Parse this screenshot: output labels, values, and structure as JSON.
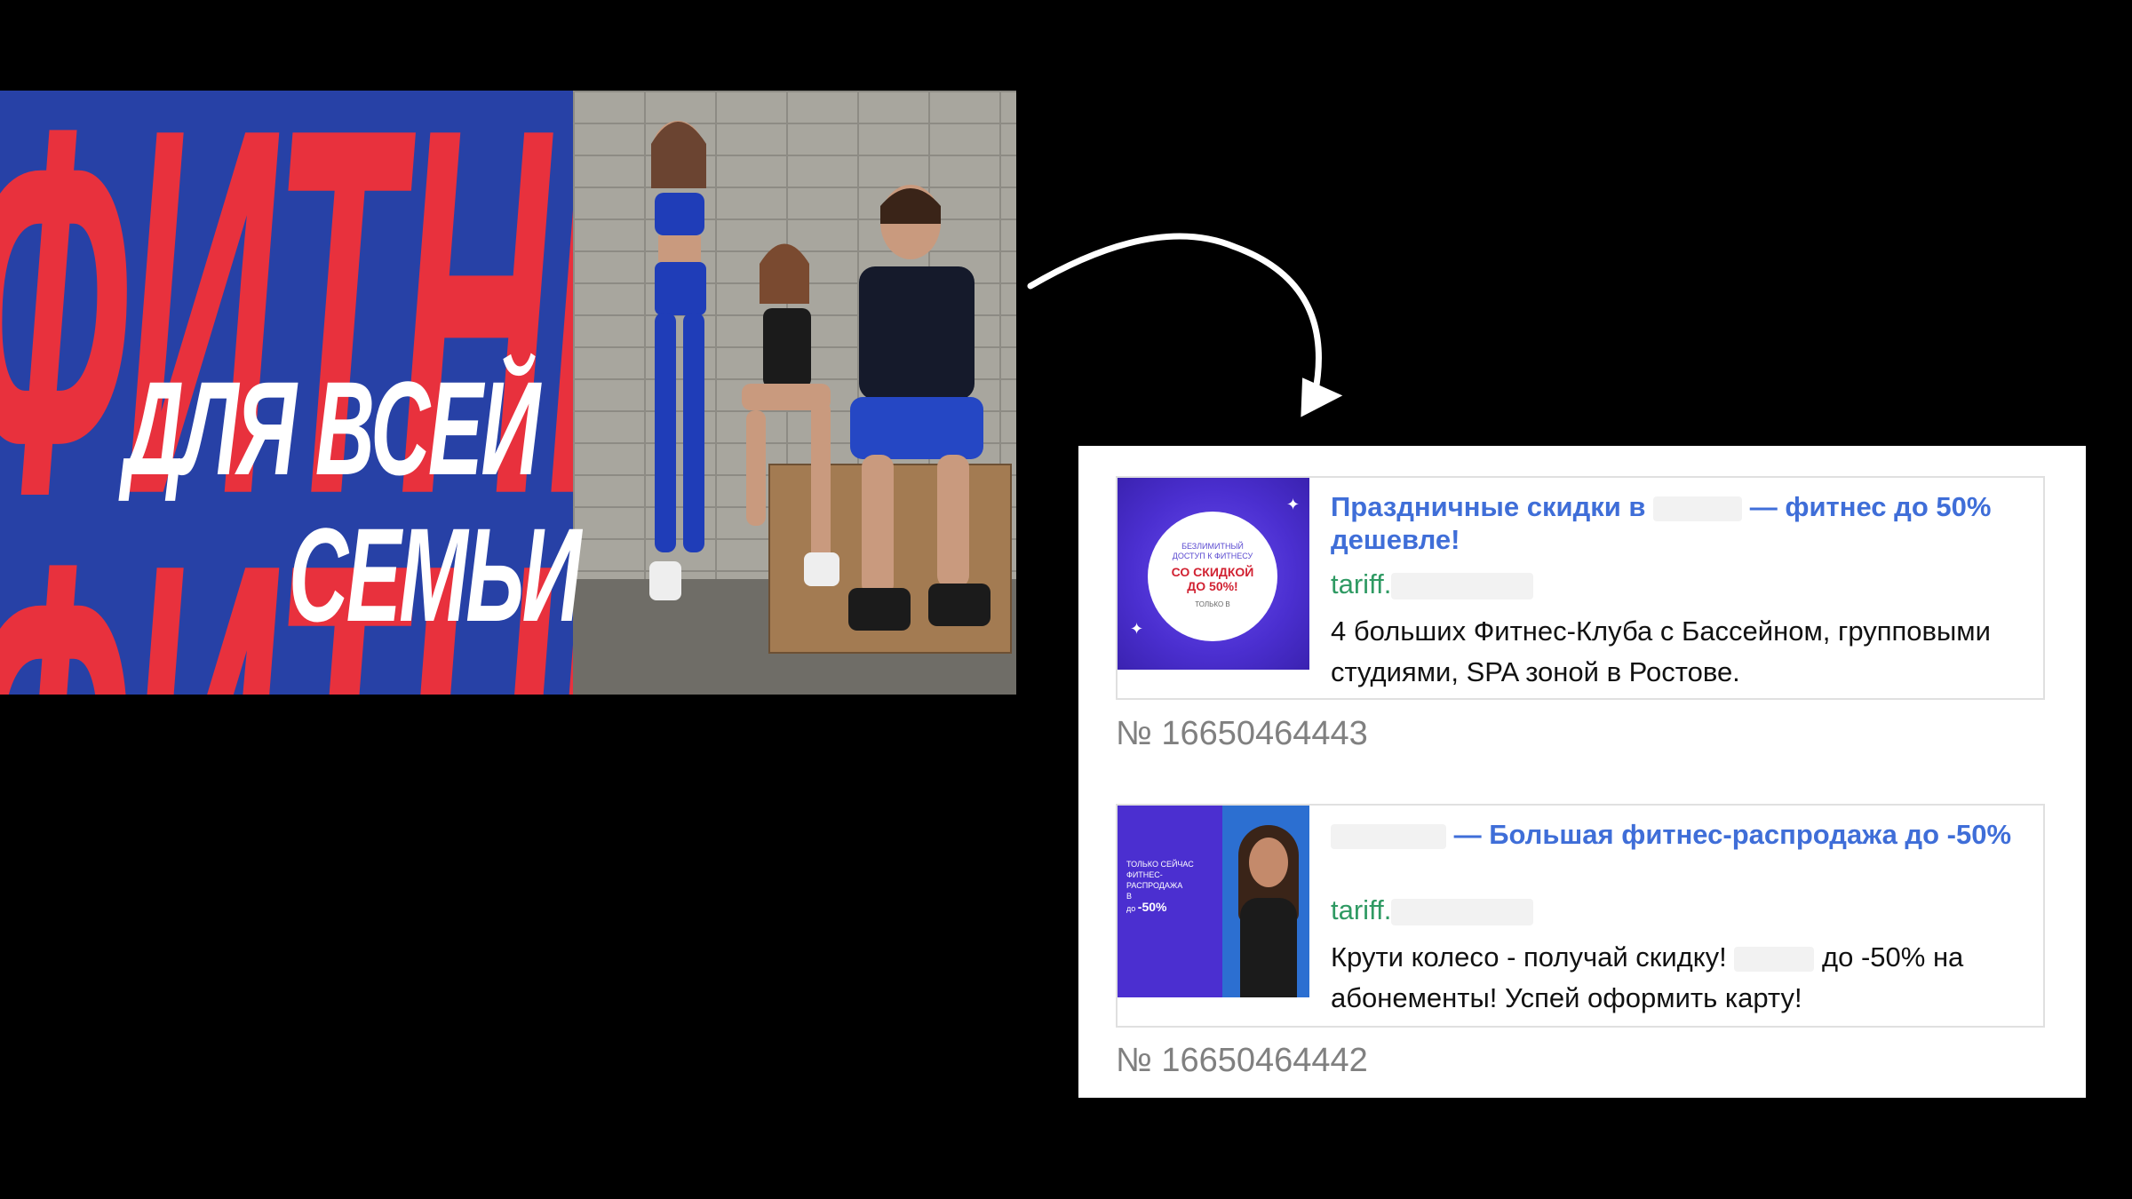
{
  "banner": {
    "background_word_top": "ФИТНЕС",
    "background_word_bottom": "ФИТНЕС",
    "slogan_line1": "ДЛЯ ВСЕЙ",
    "slogan_line2": "СЕМЬИ",
    "colors": {
      "blue": "#2741a6",
      "red": "#e8313d",
      "white": "#ffffff"
    }
  },
  "ads": [
    {
      "title_start": "Праздничные скидки в",
      "title_end": "— фитнес до 50% дешевле!",
      "url": "tariff.",
      "description": "4 больших Фитнес-Клуба с Бассейном, групповыми студиями, SPA зоной в Ростове.",
      "thumbnail": {
        "line1": "БЕЗЛИМИТНЫЙ",
        "line2": "ДОСТУП К ФИТНЕСУ",
        "highlight1": "СО СКИДКОЙ",
        "highlight2": "ДО 50%!",
        "footer": "ТОЛЬКО В"
      },
      "number": "№ 16650464443"
    },
    {
      "title_end": "— Большая фитнес-распродажа до -50%",
      "url": "tariff.",
      "description_start": "Крути колесо - получай скидку!",
      "description_end": "до -50% на абонементы! Успей оформить карту!",
      "thumbnail": {
        "line1": "ТОЛЬКО СЕЙЧАС",
        "line2": "ФИТНЕС-РАСПРОДАЖА",
        "line3": "В",
        "pct_prefix": "до",
        "pct": "-50%"
      },
      "number": "№ 16650464442"
    }
  ],
  "colors": {
    "ad_title": "#3f6ed8",
    "ad_url": "#2f9a63",
    "ad_number": "#808080",
    "thumbnail_purple": "#4b2fd0"
  }
}
